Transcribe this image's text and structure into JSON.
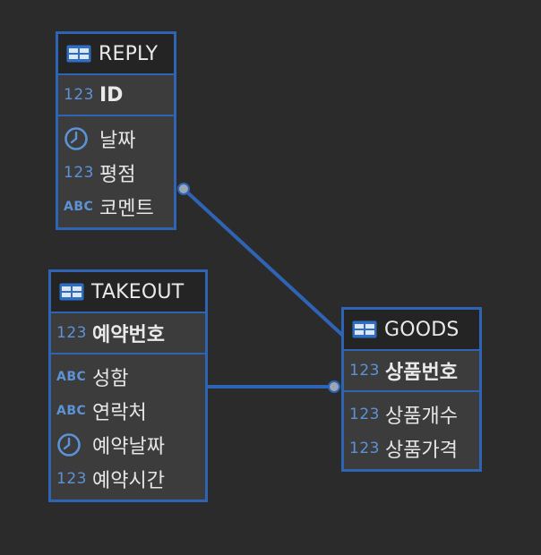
{
  "colors": {
    "background": "#2b2b2b",
    "entity_border": "#2f63b4",
    "entity_body": "#3c3c3c",
    "entity_header": "#242424",
    "type_icon": "#5b93d6",
    "text": "#e6e6e6"
  },
  "entities": {
    "reply": {
      "name": "REPLY",
      "icon": "table-icon",
      "pk": {
        "type": "123",
        "name": "ID"
      },
      "fields": [
        {
          "type": "clock-icon",
          "name": "날짜"
        },
        {
          "type": "123",
          "name": "평점"
        },
        {
          "type": "ABC",
          "name": "코멘트"
        }
      ]
    },
    "takeout": {
      "name": "TAKEOUT",
      "icon": "table-icon",
      "pk": {
        "type": "123",
        "name": "예약번호"
      },
      "fields": [
        {
          "type": "ABC",
          "name": "성함"
        },
        {
          "type": "ABC",
          "name": "연락처"
        },
        {
          "type": "clock-icon",
          "name": "예약날짜"
        },
        {
          "type": "123",
          "name": "예약시간"
        }
      ]
    },
    "goods": {
      "name": "GOODS",
      "icon": "table-icon",
      "pk": {
        "type": "123",
        "name": "상품번호"
      },
      "fields": [
        {
          "type": "123",
          "name": "상품개수"
        },
        {
          "type": "123",
          "name": "상품가격"
        }
      ]
    }
  },
  "relationships": [
    {
      "from": "REPLY",
      "to": "GOODS"
    },
    {
      "from": "TAKEOUT",
      "to": "GOODS"
    }
  ],
  "type_labels": {
    "num": "123",
    "abc": "ABC"
  }
}
